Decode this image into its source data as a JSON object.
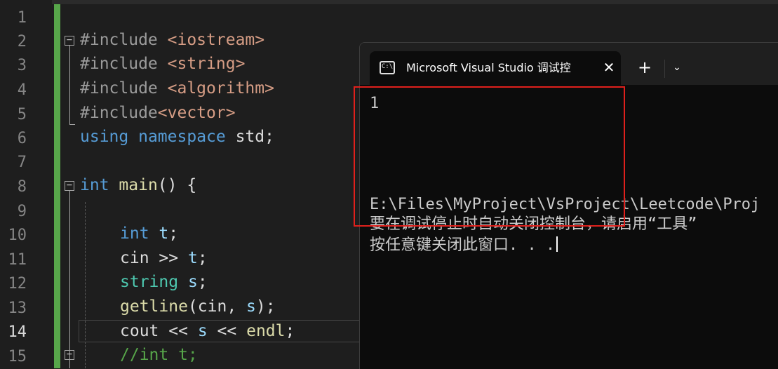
{
  "editor": {
    "line_numbers": [
      "1",
      "2",
      "3",
      "4",
      "5",
      "6",
      "7",
      "8",
      "9",
      "10",
      "11",
      "12",
      "13",
      "14",
      "15"
    ],
    "active_line": "14",
    "code": {
      "l2": {
        "kw": "#include",
        "arg": "<iostream>"
      },
      "l3": {
        "kw": "#include",
        "arg": "<string>"
      },
      "l4": {
        "kw": "#include",
        "arg": "<algorithm>"
      },
      "l5": {
        "kw": "#include",
        "arg": "<vector>"
      },
      "l6": {
        "kw1": "using",
        "kw2": "namespace",
        "rest": "std;"
      },
      "l8": {
        "type": "int",
        "fn": "main",
        "rest": "() {"
      },
      "l10": {
        "type": "int",
        "var": "t",
        "rest": ";"
      },
      "l11": {
        "a": "cin",
        "op": ">>",
        "var": "t",
        "rest": ";"
      },
      "l12": {
        "type": "string",
        "var": "s",
        "rest": ";"
      },
      "l13": {
        "fn": "getline",
        "mid": "(cin, ",
        "var": "s",
        "rest": ");"
      },
      "l14": {
        "a": "cout",
        "op1": "<<",
        "var": "s",
        "op2": "<<",
        "b": "endl",
        "rest": ";"
      },
      "l15": {
        "comment": "//int t;"
      }
    }
  },
  "terminal": {
    "tab_title": "Microsoft Visual Studio 调试控",
    "tab_icon": "C:\\",
    "close_glyph": "✕",
    "new_tab_glyph": "+",
    "dropdown_glyph": "⌄",
    "output": [
      "1",
      "",
      "",
      "E:\\Files\\MyProject\\VsProject\\Leetcode\\Proj",
      "要在调试停止时自动关闭控制台，请启用“工具”",
      "按任意键关闭此窗口. . ."
    ]
  },
  "colors": {
    "change_bar": "#57a64a",
    "keyword": "#569cd6",
    "include_path": "#d69d85",
    "variable": "#9cdcfe",
    "type": "#4ec9b0",
    "function": "#dcdcaa",
    "comment": "#57a64a",
    "highlight_box": "#e0201c"
  }
}
